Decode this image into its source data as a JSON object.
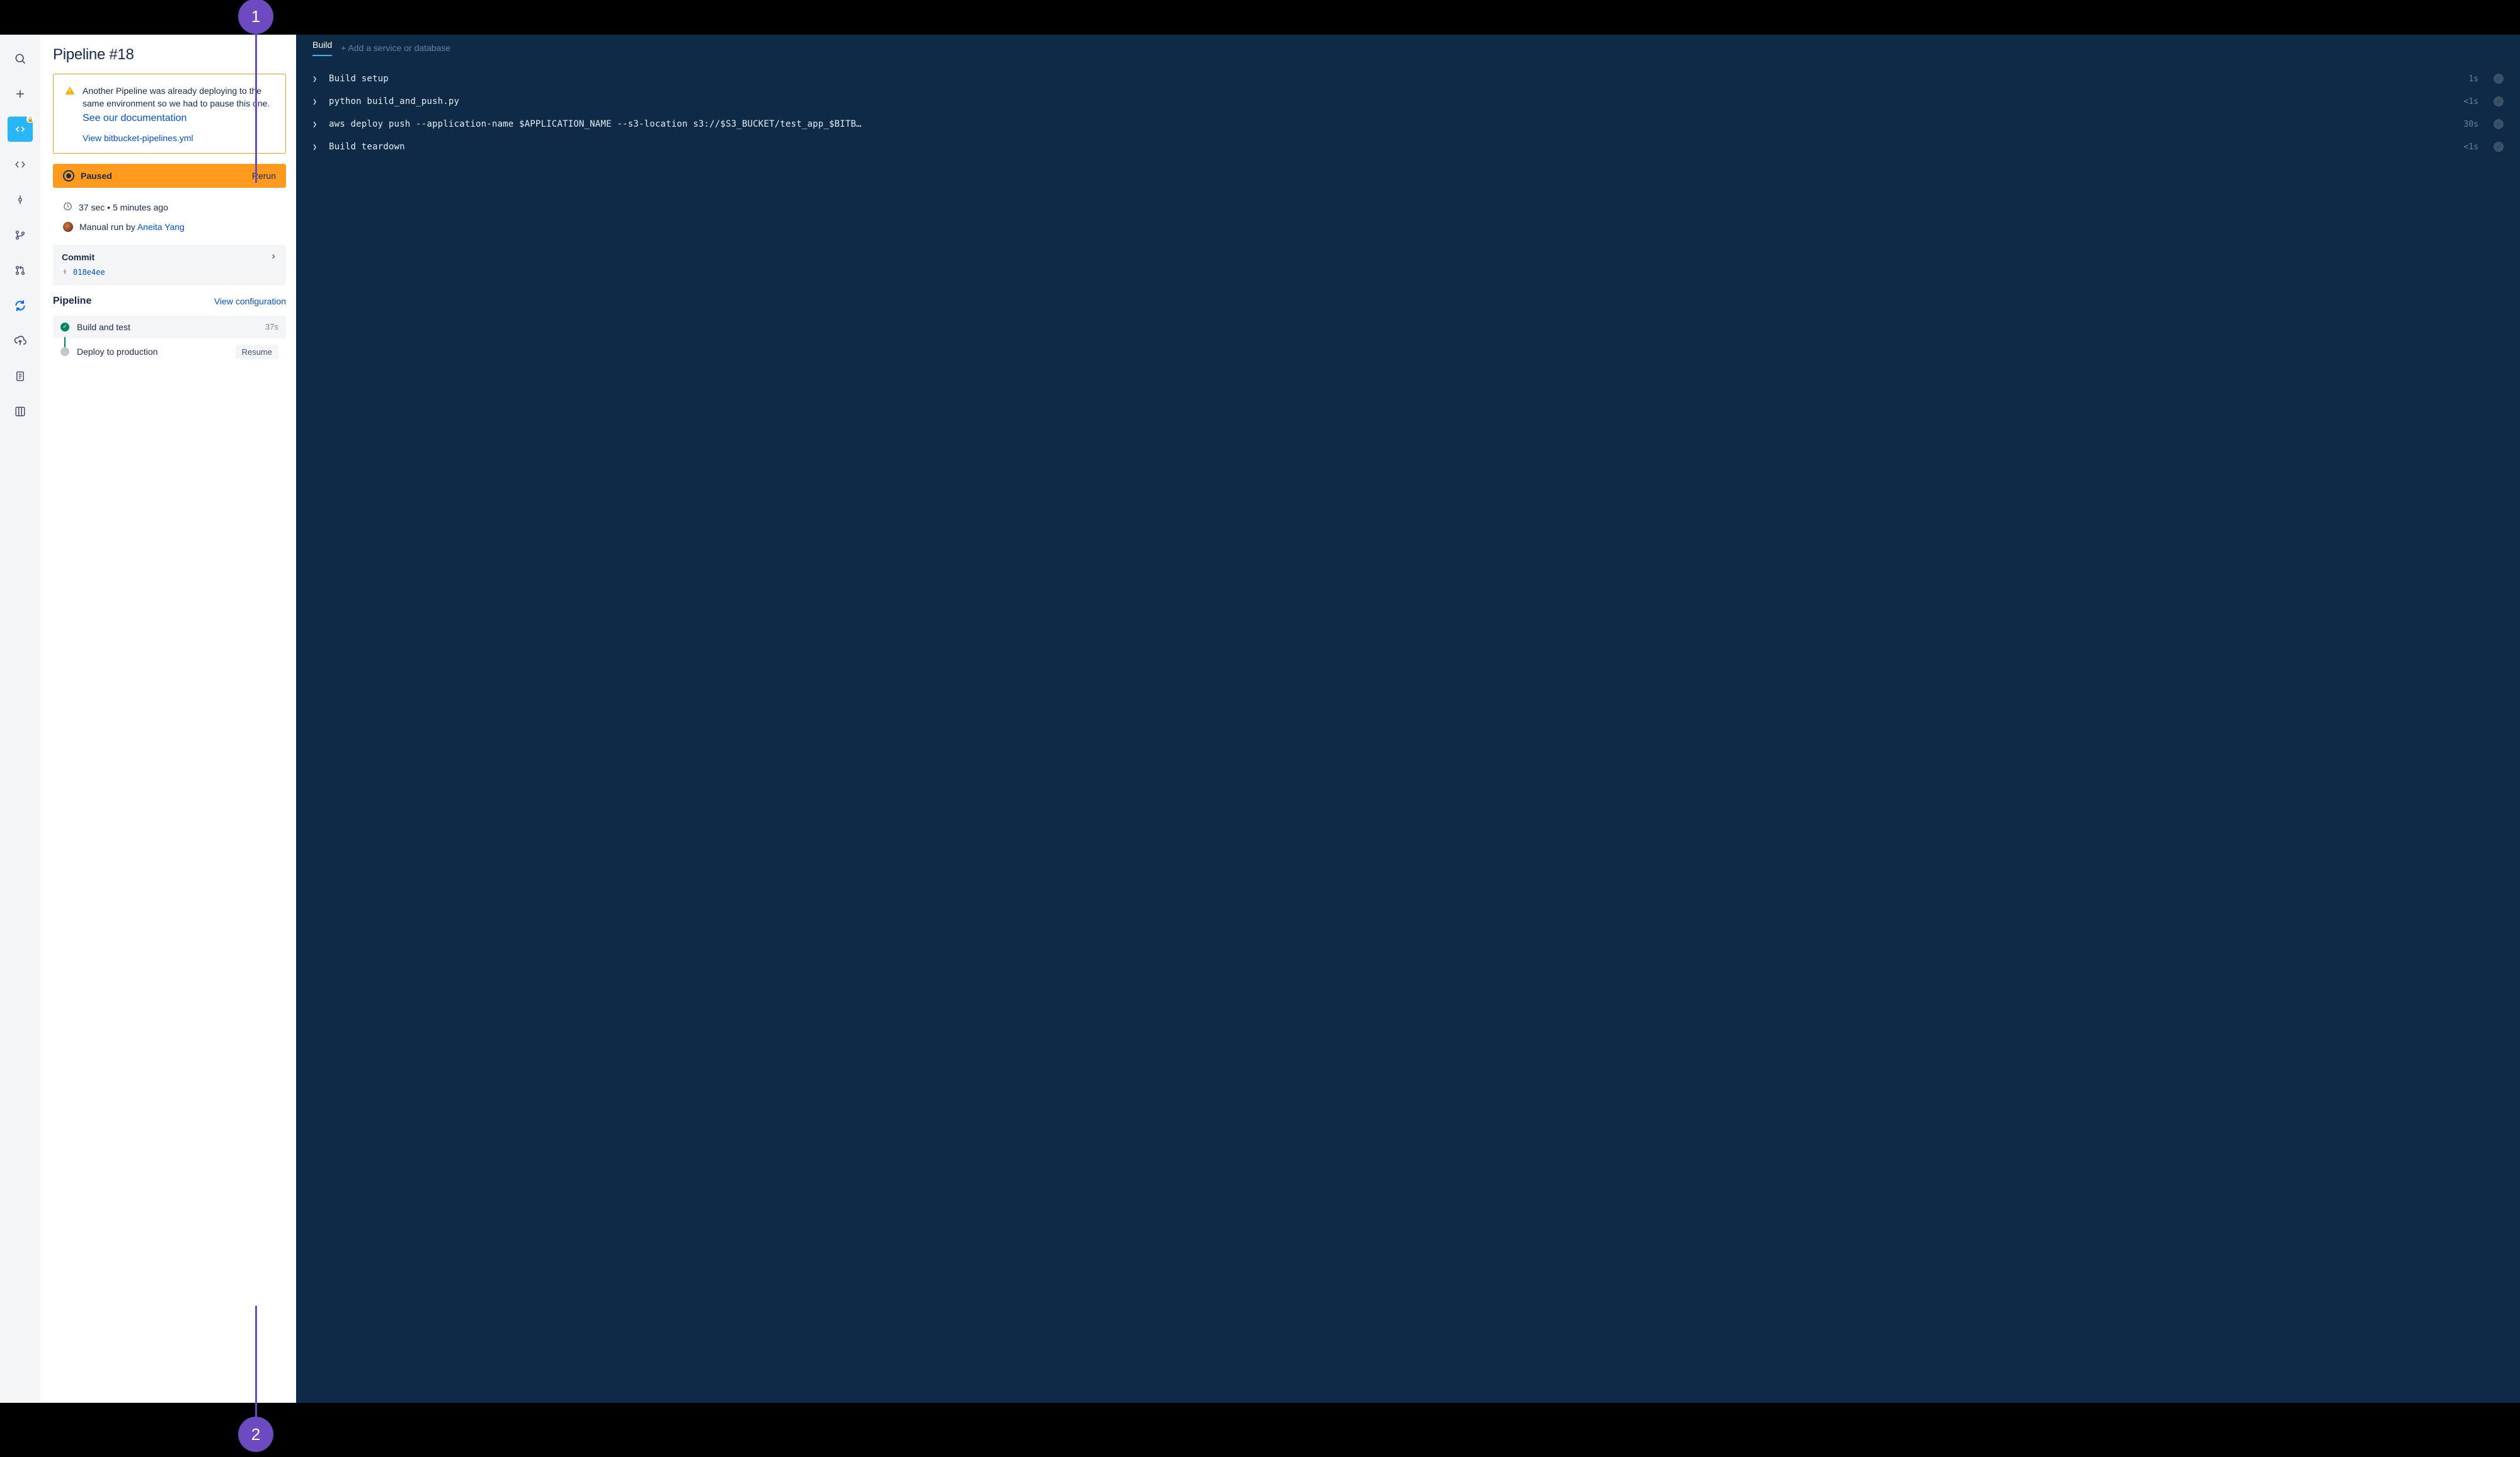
{
  "callouts": {
    "one": "1",
    "two": "2"
  },
  "rail": {
    "items": [
      {
        "name": "search-icon"
      },
      {
        "name": "create-icon"
      },
      {
        "name": "source-icon",
        "active": true
      },
      {
        "name": "code-icon"
      },
      {
        "name": "commit-icon"
      },
      {
        "name": "branches-icon"
      },
      {
        "name": "pull-requests-icon"
      },
      {
        "name": "pipelines-icon"
      },
      {
        "name": "deployments-icon"
      },
      {
        "name": "downloads-icon"
      },
      {
        "name": "boards-icon"
      }
    ]
  },
  "panel": {
    "title": "Pipeline #18",
    "alert": {
      "message": "Another Pipeline was already deploying to the same environment so we had to pause this one.",
      "docs_link": "See our documentation",
      "view_yml": "View bitbucket-pipelines.yml"
    },
    "status": {
      "label": "Paused",
      "action": "Rerun"
    },
    "meta": {
      "duration": "37 sec",
      "separator": "•",
      "ago": "5 minutes ago",
      "runby_prefix": "Manual run by ",
      "runby_user": "Aneita Yang"
    },
    "commit": {
      "heading": "Commit",
      "hash": "018e4ee"
    },
    "pipeline": {
      "heading": "Pipeline",
      "view_config": "View configuration",
      "steps": [
        {
          "label": "Build and test",
          "duration": "37s",
          "status": "success"
        },
        {
          "label": "Deploy to production",
          "action": "Resume",
          "status": "pending"
        }
      ]
    }
  },
  "log": {
    "tab": "Build",
    "add_service": "+ Add a service or database",
    "lines": [
      {
        "cmd": "Build setup",
        "time": "1s"
      },
      {
        "cmd": "python build_and_push.py",
        "time": "<1s"
      },
      {
        "cmd": "aws deploy push --application-name $APPLICATION_NAME --s3-location s3://$S3_BUCKET/test_app_$BITB…",
        "time": "30s"
      },
      {
        "cmd": "Build teardown",
        "time": "<1s"
      }
    ]
  }
}
